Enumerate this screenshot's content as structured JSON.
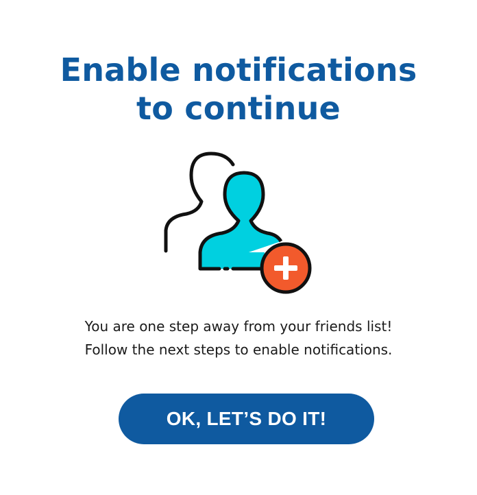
{
  "dialog": {
    "title_line1": "Enable notifications",
    "title_line2": "to continue",
    "message_line1": "You are one step away from your friends list!",
    "message_line2": "Follow the next steps to enable notifications.",
    "button_label": "OK, LET’S DO IT!"
  },
  "illustration": {
    "icon": "add-friend-icon",
    "colors": {
      "person_fill": "#00d0e0",
      "badge_fill": "#f25a2c",
      "outline": "#111111"
    }
  },
  "colors": {
    "title": "#0f5aa0",
    "button_background": "#0f5aa0",
    "button_text": "#ffffff",
    "body_text": "#1a1a1a",
    "background": "#ffffff"
  }
}
